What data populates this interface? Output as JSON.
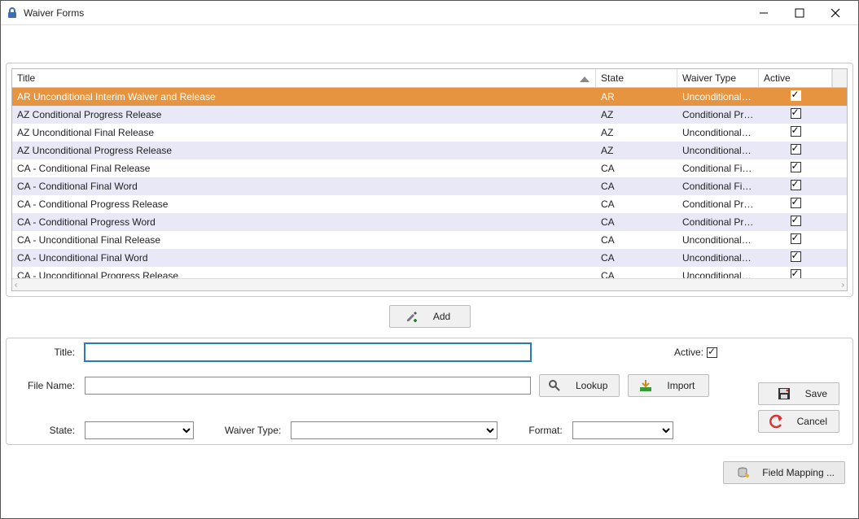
{
  "window": {
    "title": "Waiver Forms"
  },
  "grid": {
    "headers": {
      "title": "Title",
      "state": "State",
      "waiver_type": "Waiver Type",
      "active": "Active"
    },
    "rows": [
      {
        "title": "AR Unconditional Interim Waiver and Release",
        "state": "AR",
        "waiver_type": "Unconditional Final",
        "active": true,
        "selected": true
      },
      {
        "title": "AZ Conditional Progress Release",
        "state": "AZ",
        "waiver_type": "Conditional Progr...",
        "active": true
      },
      {
        "title": "AZ Unconditional Final Release",
        "state": "AZ",
        "waiver_type": "Unconditional Final",
        "active": true
      },
      {
        "title": "AZ Unconditional Progress Release",
        "state": "AZ",
        "waiver_type": "Unconditional Pro...",
        "active": true
      },
      {
        "title": "CA - Conditional Final Release",
        "state": "CA",
        "waiver_type": "Conditional Final",
        "active": true
      },
      {
        "title": "CA - Conditional Final Word",
        "state": "CA",
        "waiver_type": "Conditional Final",
        "active": true
      },
      {
        "title": "CA - Conditional Progress Release",
        "state": "CA",
        "waiver_type": "Conditional Progr...",
        "active": true
      },
      {
        "title": "CA - Conditional Progress Word",
        "state": "CA",
        "waiver_type": "Conditional Progr...",
        "active": true
      },
      {
        "title": "CA - Unconditional Final Release",
        "state": "CA",
        "waiver_type": "Unconditional Final",
        "active": true
      },
      {
        "title": "CA - Unconditional Final Word",
        "state": "CA",
        "waiver_type": "Unconditional Final",
        "active": true
      },
      {
        "title": "CA - Unconditional Progress Release",
        "state": "CA",
        "waiver_type": "Unconditional Pro...",
        "active": true
      }
    ]
  },
  "buttons": {
    "add": "Add",
    "lookup": "Lookup",
    "import": "Import",
    "save": "Save",
    "cancel": "Cancel",
    "field_mapping": "Field Mapping ..."
  },
  "form": {
    "labels": {
      "title": "Title:",
      "file_name": "File Name:",
      "state": "State:",
      "waiver_type": "Waiver Type:",
      "format": "Format:",
      "active": "Active:"
    },
    "values": {
      "title": "",
      "file_name": "",
      "state": "",
      "waiver_type": "",
      "format": "",
      "active_checked": true
    }
  },
  "icons": {
    "lock": "lock-icon",
    "pen": "pen-add-icon",
    "magnifier": "magnifier-icon",
    "import": "import-icon",
    "save": "floppy-icon",
    "cancel": "undo-arrow-icon",
    "db": "db-link-icon"
  }
}
